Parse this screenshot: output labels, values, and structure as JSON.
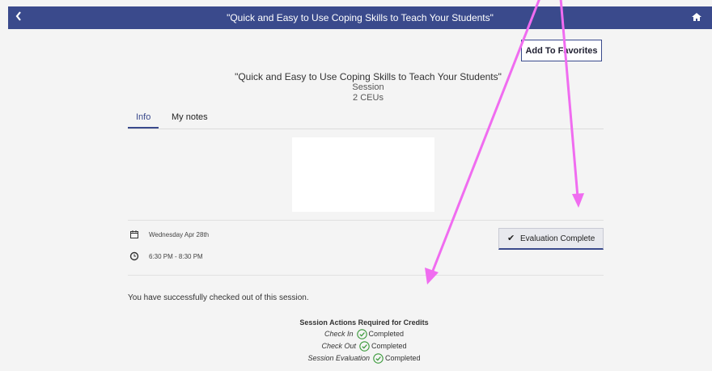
{
  "window": {
    "back_icon": "chevron-left-icon",
    "title": "\"Quick and Easy to Use Coping Skills to Teach Your Students\"",
    "home_icon": "home-icon"
  },
  "header": {
    "favorite_label": "Add To Favorites",
    "session_title": "\"Quick and Easy to Use Coping Skills to Teach Your Students\"",
    "session_type": "Session",
    "ceus": "2 CEUs"
  },
  "tabs": [
    {
      "label": "Info",
      "active": true
    },
    {
      "label": "My notes",
      "active": false
    }
  ],
  "details": {
    "date": "Wednesday Apr 28th",
    "time": "6:30 PM - 8:30 PM",
    "date_icon": "calendar-icon",
    "time_icon": "clock-icon"
  },
  "evaluation_button": {
    "label": "Evaluation Complete",
    "icon": "checkmark-icon"
  },
  "status_message": "You have successfully checked out of this session.",
  "actions": {
    "heading": "Session Actions Required for Credits",
    "items": [
      {
        "name": "Check In",
        "status": "Completed"
      },
      {
        "name": "Check Out",
        "status": "Completed"
      },
      {
        "name": "Session Evaluation",
        "status": "Completed"
      }
    ],
    "status_icon": "check-circle-icon"
  },
  "colors": {
    "brand": "#3a4a8c",
    "success": "#3c9a3c",
    "annotation": "#f06cf0"
  }
}
